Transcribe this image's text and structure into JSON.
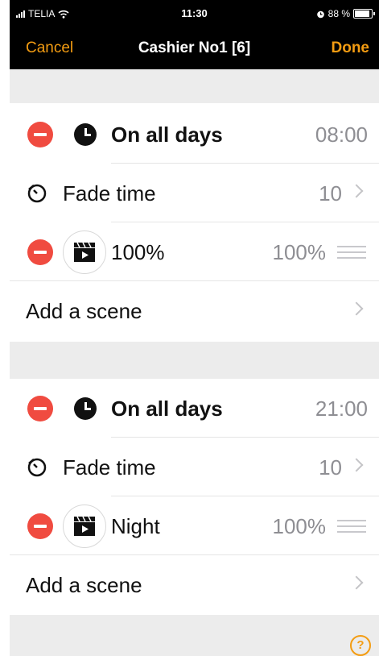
{
  "status_bar": {
    "carrier": "TELIA",
    "time": "11:30",
    "battery_text": "88 %",
    "battery_level": 0.88
  },
  "nav": {
    "cancel_label": "Cancel",
    "title": "Cashier No1 [6]",
    "done_label": "Done"
  },
  "blocks": [
    {
      "schedule_label": "On all days",
      "schedule_time": "08:00",
      "fade_label": "Fade time",
      "fade_value": "10",
      "scene_name": "100%",
      "scene_value": "100%",
      "add_scene_label": "Add a scene"
    },
    {
      "schedule_label": "On all days",
      "schedule_time": "21:00",
      "fade_label": "Fade time",
      "fade_value": "10",
      "scene_name": "Night",
      "scene_value": "100%",
      "add_scene_label": "Add a scene"
    }
  ],
  "help_label": "?",
  "colors": {
    "accent": "#f39c12",
    "delete": "#f04b40",
    "separator": "#ececec"
  },
  "icons": [
    "signal-icon",
    "wifi-icon",
    "alarm-icon",
    "battery-icon",
    "minus-icon",
    "clock-icon",
    "timer-icon",
    "clapperboard-icon",
    "chevron-right-icon",
    "drag-handle-icon",
    "help-icon"
  ]
}
